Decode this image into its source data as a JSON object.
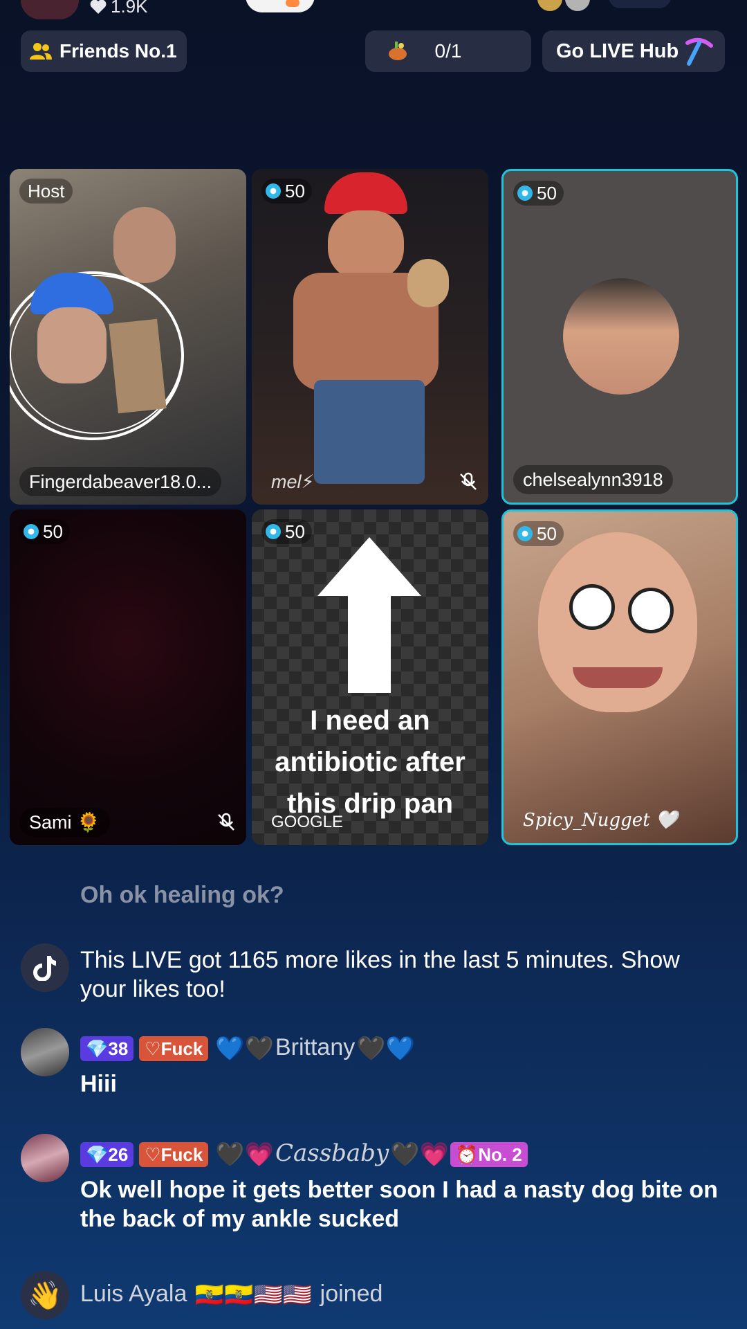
{
  "header": {
    "likes": "1.9K",
    "friends_pill": "Friends No.1",
    "goal_counter": "0/1",
    "hub_button": "Go LIVE Hub"
  },
  "tiles": [
    {
      "badge": "Host",
      "name": "Fingerdabeaver18.0..."
    },
    {
      "badge": "50",
      "name": "mel⚡"
    },
    {
      "badge": "50",
      "name": "chelsealynn3918"
    },
    {
      "badge": "50",
      "name": "Sami 🌻"
    },
    {
      "badge": "50",
      "name": "GOOGLE",
      "overlay": "I need an antibiotic after this drip pan"
    },
    {
      "badge": "50",
      "name": "Spicy_Nugget 🤍"
    }
  ],
  "chat": [
    {
      "text": "Oh ok healing ok?"
    },
    {
      "text": "This LIVE got 1165 more likes in the last 5 minutes. Show your likes too!"
    },
    {
      "level": "38",
      "badge": "Fuck",
      "name": "Brittany",
      "text": "Hiii"
    },
    {
      "level": "26",
      "badge": "Fuck",
      "name": "Cassbaby",
      "rank": "No. 2",
      "text": "Ok well hope it gets better soon I had a nasty dog bite on the back of my ankle sucked"
    },
    {
      "name": "Luis Ayala",
      "text": "joined"
    }
  ],
  "colors": {
    "accent": "#20c3d8",
    "level": "#5a3be0",
    "fan_badge": "#d9553a"
  }
}
